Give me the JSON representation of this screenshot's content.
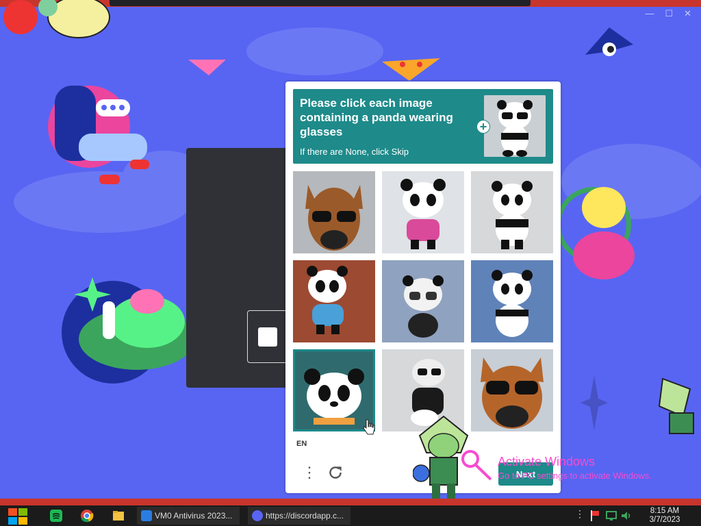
{
  "window": {
    "title": "",
    "controls": [
      "—",
      "☐",
      "✕"
    ]
  },
  "captcha": {
    "prompt_title": "Please click each image containing a panda wearing glasses",
    "prompt_sub": "If there are None, click Skip",
    "tiles": [
      {
        "subject": "dog-with-sunglasses",
        "selected": false
      },
      {
        "subject": "panda-pink-shirt",
        "selected": false
      },
      {
        "subject": "panda-standing",
        "selected": false
      },
      {
        "subject": "panda-blue-shirt",
        "selected": false
      },
      {
        "subject": "panda-with-glasses",
        "selected": false
      },
      {
        "subject": "panda-sitting",
        "selected": false
      },
      {
        "subject": "panda-face",
        "selected": true
      },
      {
        "subject": "panda-with-glasses-dark",
        "selected": false
      },
      {
        "subject": "dog-with-sunglasses",
        "selected": false
      }
    ],
    "language": "EN",
    "menu_icon": "more-vertical-icon",
    "refresh_icon": "refresh-icon",
    "next_label": "Next"
  },
  "watermark": {
    "line1": "Activate Windows",
    "line2": "Go to PC settings to activate Windows."
  },
  "taskbar": {
    "tasks": [
      {
        "label": "VM0 Antivirus 2023...",
        "icon": "shield-icon"
      },
      {
        "label": "https://discordapp.c...",
        "icon": "discord-icon"
      }
    ],
    "time": "8:15 AM",
    "date": "3/7/2023"
  },
  "colors": {
    "discord_blurple": "#5865f2",
    "captcha_teal": "#1e8a8a",
    "watermark_pink": "#f84bd0",
    "taskbar": "#1b1b1b"
  }
}
